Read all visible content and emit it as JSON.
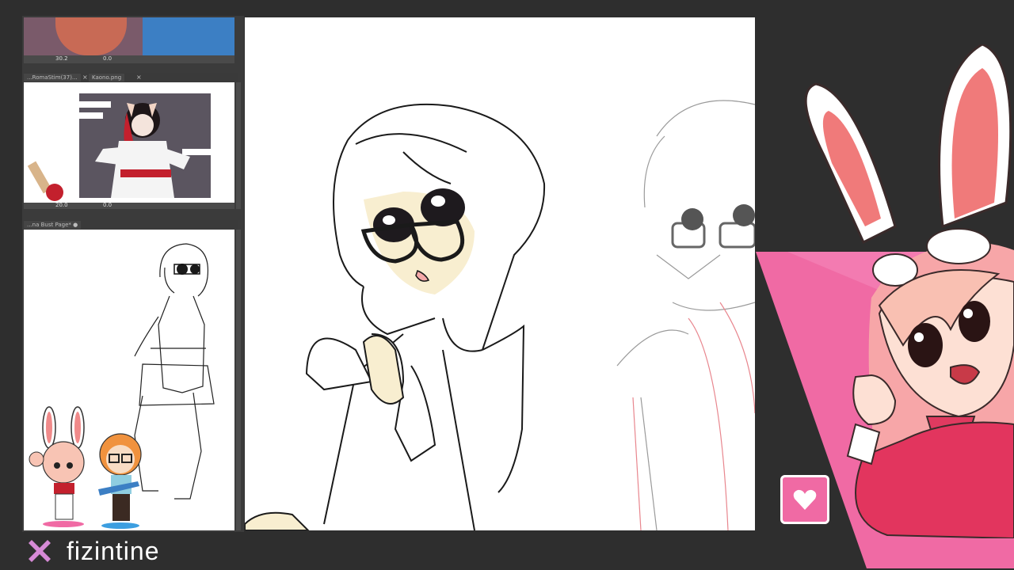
{
  "reference_top": {
    "zoom": "30.2",
    "angle": "0.0"
  },
  "tabs_mid": {
    "tab1": "...RomaStim(37)...",
    "tab2": "Kaono.png"
  },
  "reference_mid": {
    "zoom": "20.0",
    "angle": "0.0"
  },
  "tabs_bot": {
    "tab1": "...na Bust Page* ●"
  },
  "brand": {
    "name": "fizintine",
    "accent": "#d68ad6"
  },
  "colors": {
    "pink": "#f06aa4",
    "background": "#2e2e2e"
  },
  "icons": {
    "close": "×",
    "heart": "heart-icon",
    "brand": "x-logo-icon"
  }
}
